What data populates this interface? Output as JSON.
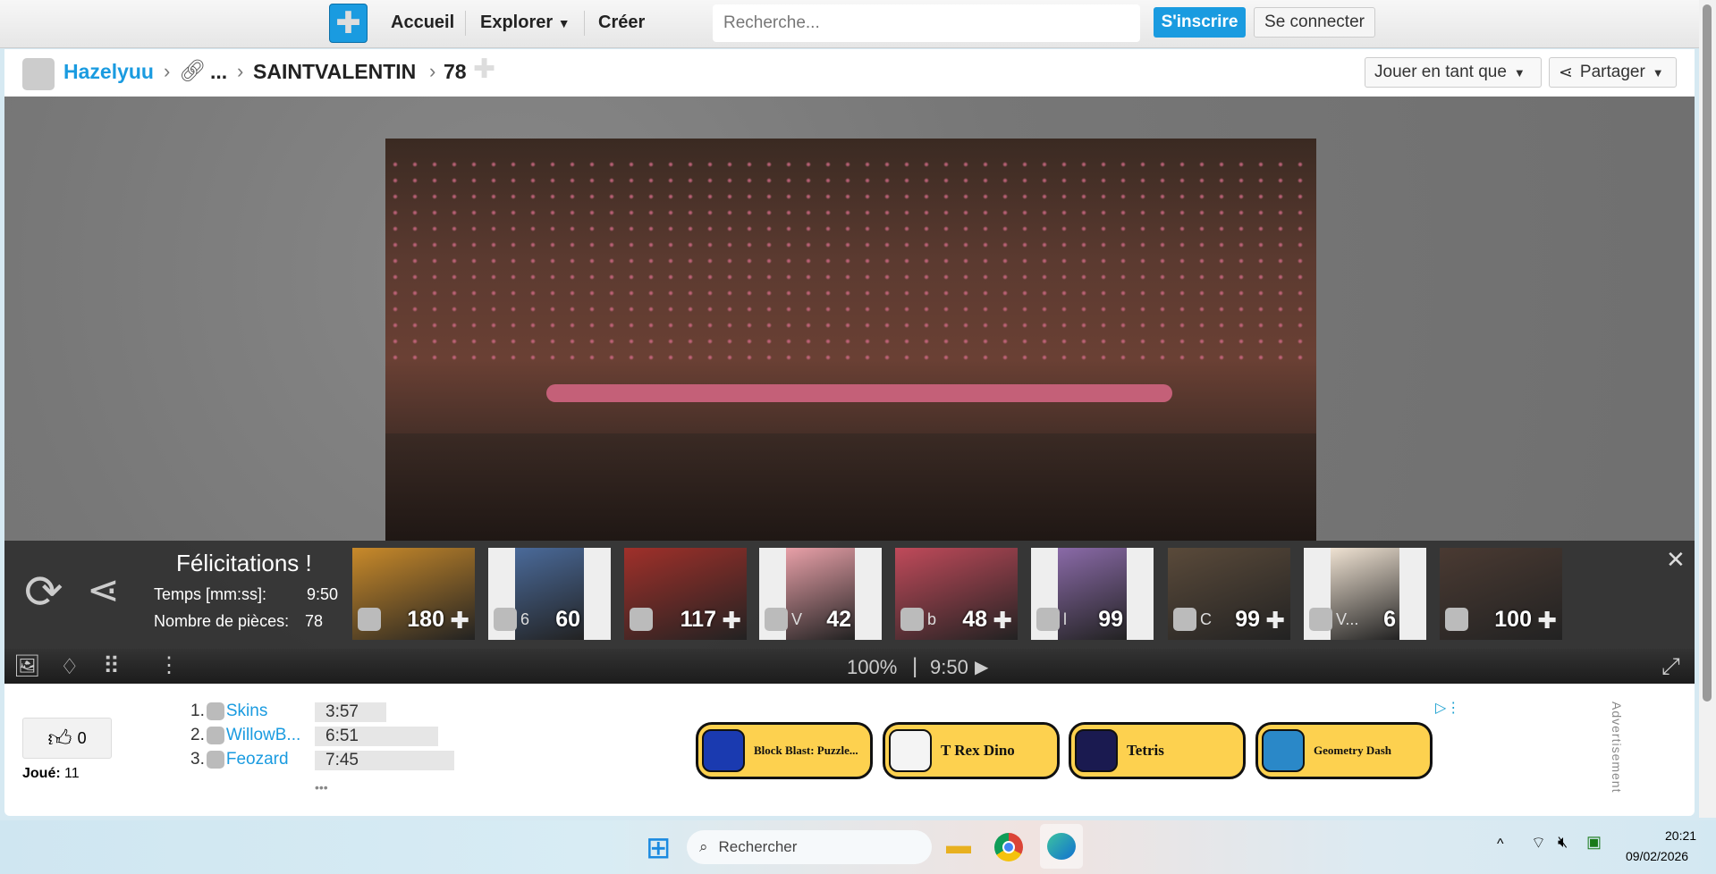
{
  "nav": {
    "home": "Accueil",
    "explore": "Explorer",
    "create": "Créer",
    "search_placeholder": "Recherche...",
    "signup": "S'inscrire",
    "login": "Se connecter"
  },
  "breadcrumb": {
    "user": "Hazelyuu",
    "ellipsis": "...",
    "collection": "SAINTVALENTIN",
    "pieces": "78"
  },
  "actions": {
    "play_as": "Jouer en tant que",
    "share": "Partager"
  },
  "completion": {
    "title": "Félicitations !",
    "time_label": "Temps [mm:ss]:",
    "time_value": "9:50",
    "pieces_label": "Nombre de pièces:",
    "pieces_value": "78"
  },
  "suggestions": [
    {
      "count": "180",
      "author": "",
      "color": "#c98a2a"
    },
    {
      "count": "60",
      "author": "6",
      "color": "#4a6a9a"
    },
    {
      "count": "117",
      "author": "",
      "color": "#a0302a"
    },
    {
      "count": "42",
      "author": "V",
      "color": "#e8a0a8"
    },
    {
      "count": "48",
      "author": "b",
      "color": "#c04a5a"
    },
    {
      "count": "99",
      "author": "l",
      "color": "#8a6aa8"
    },
    {
      "count": "99",
      "author": "C",
      "color": "#5a4a3a"
    },
    {
      "count": "6",
      "author": "V...",
      "color": "#efe2d2"
    },
    {
      "count": "100",
      "author": "",
      "color": "#4a3a32"
    }
  ],
  "toolbar": {
    "zoom": "100%",
    "divider": "|",
    "timer": "9:50"
  },
  "likes": {
    "count": "0",
    "played_label": "Joué:",
    "played_value": "11"
  },
  "leaderboard": [
    {
      "rank": "1.",
      "name": "Skins",
      "time": "3:57"
    },
    {
      "rank": "2.",
      "name": "WillowB...",
      "time": "6:51"
    },
    {
      "rank": "3.",
      "name": "Feozard",
      "time": "7:45"
    }
  ],
  "leaderboard_more": "•••",
  "ads": {
    "items": [
      "Block Blast: Puzzle...",
      "T Rex Dino",
      "Tetris",
      "Geometry Dash"
    ],
    "label": "Advertisement"
  },
  "taskbar": {
    "search": "Rechercher",
    "time": "20:21",
    "date": "09/02/2026"
  }
}
